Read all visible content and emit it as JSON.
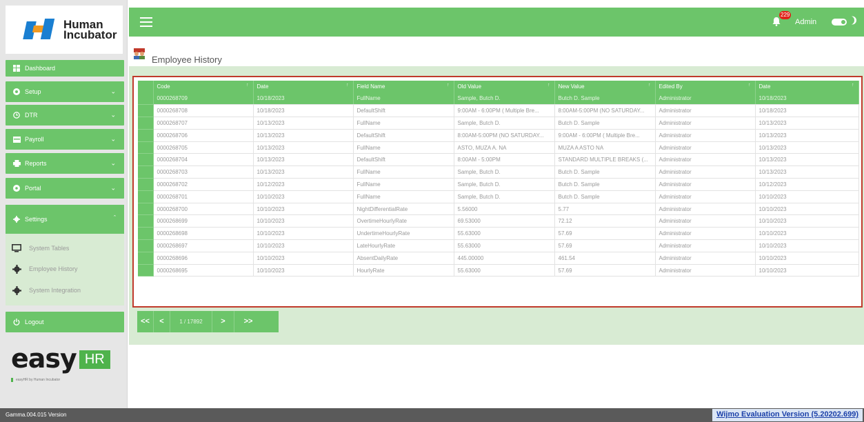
{
  "brand": {
    "line1": "Human",
    "line2": "Incubator"
  },
  "sidebar": {
    "items": [
      {
        "label": "Dashboard",
        "icon": "dashboard-icon"
      },
      {
        "label": "Setup",
        "icon": "setup-icon"
      },
      {
        "label": "DTR",
        "icon": "clock-icon"
      },
      {
        "label": "Payroll",
        "icon": "payroll-icon"
      },
      {
        "label": "Reports",
        "icon": "printer-icon"
      },
      {
        "label": "Portal",
        "icon": "portal-icon"
      }
    ],
    "settings": {
      "label": "Settings",
      "sub_items": [
        {
          "label": "System Tables",
          "icon": "monitor-icon"
        },
        {
          "label": "Employee History",
          "icon": "gear-icon"
        },
        {
          "label": "System Integration",
          "icon": "gear-icon"
        }
      ]
    },
    "logout": "Logout",
    "easy_logo": {
      "word": "easy",
      "hr": "HR",
      "tagline": "easyHR by Human Incubator"
    }
  },
  "topbar": {
    "notification_count": "229",
    "user": "Admin"
  },
  "page": {
    "title": "Employee History"
  },
  "grid": {
    "columns": [
      "Code",
      "Date",
      "Field Name",
      "Old Value",
      "New Value",
      "Edited By",
      "Date"
    ],
    "rows": [
      [
        "0000268709",
        "10/18/2023",
        "FullName",
        "Sample, Butch D.",
        "Butch D. Sample",
        "Administrator",
        "10/18/2023"
      ],
      [
        "0000268708",
        "10/18/2023",
        "DefaultShift",
        "9:00AM - 6:00PM ( Multiple Bre...",
        "8:00AM-5:00PM (NO SATURDAY...",
        "Administrator",
        "10/18/2023"
      ],
      [
        "0000268707",
        "10/13/2023",
        "FullName",
        "Sample, Butch D.",
        "Butch D. Sample",
        "Administrator",
        "10/13/2023"
      ],
      [
        "0000268706",
        "10/13/2023",
        "DefaultShift",
        "8:00AM-5:00PM (NO SATURDAY...",
        "9:00AM - 6:00PM ( Multiple Bre...",
        "Administrator",
        "10/13/2023"
      ],
      [
        "0000268705",
        "10/13/2023",
        "FullName",
        "ASTO, MUZA A. NA",
        "MUZA A ASTO NA",
        "Administrator",
        "10/13/2023"
      ],
      [
        "0000268704",
        "10/13/2023",
        "DefaultShift",
        "8:00AM - 5:00PM",
        "STANDARD MULTIPLE BREAKS (...",
        "Administrator",
        "10/13/2023"
      ],
      [
        "0000268703",
        "10/13/2023",
        "FullName",
        "Sample, Butch D.",
        "Butch D. Sample",
        "Administrator",
        "10/13/2023"
      ],
      [
        "0000268702",
        "10/12/2023",
        "FullName",
        "Sample, Butch D.",
        "Butch D. Sample",
        "Administrator",
        "10/12/2023"
      ],
      [
        "0000268701",
        "10/10/2023",
        "FullName",
        "Sample, Butch D.",
        "Butch D. Sample",
        "Administrator",
        "10/10/2023"
      ],
      [
        "0000268700",
        "10/10/2023",
        "NightDifferentialRate",
        "5.56000",
        "5.77",
        "Administrator",
        "10/10/2023"
      ],
      [
        "0000268699",
        "10/10/2023",
        "OvertimeHourlyRate",
        "69.53000",
        "72.12",
        "Administrator",
        "10/10/2023"
      ],
      [
        "0000268698",
        "10/10/2023",
        "UndertimeHourlyRate",
        "55.63000",
        "57.69",
        "Administrator",
        "10/10/2023"
      ],
      [
        "0000268697",
        "10/10/2023",
        "LateHourlyRate",
        "55.63000",
        "57.69",
        "Administrator",
        "10/10/2023"
      ],
      [
        "0000268696",
        "10/10/2023",
        "AbsentDailyRate",
        "445.00000",
        "461.54",
        "Administrator",
        "10/10/2023"
      ],
      [
        "0000268695",
        "10/10/2023",
        "HourlyRate",
        "55.63000",
        "57.69",
        "Administrator",
        "10/10/2023"
      ]
    ]
  },
  "pager": {
    "first": "<<",
    "prev": "<",
    "info": "1 / 17892",
    "next": ">",
    "last": ">>"
  },
  "footer": {
    "version": "Gamma.004.015 Version",
    "wijmo": "Wijmo Evaluation Version (5.20202.699)"
  }
}
